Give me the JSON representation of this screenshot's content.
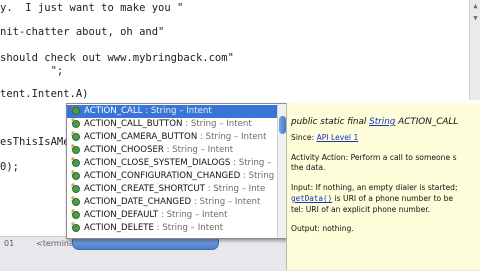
{
  "editor": {
    "lines": [
      "y.  I just want to make you \"",
      "nit-chatter about, oh and\"",
      "should check out www.mybringback.com\"",
      "        \";",
      "tent.Intent.A)",
      "esThisIsAMet",
      "0);"
    ]
  },
  "autocomplete": {
    "items": [
      {
        "name": "ACTION_CALL",
        "type": "String – Intent"
      },
      {
        "name": "ACTION_CALL_BUTTON",
        "type": "String – Intent"
      },
      {
        "name": "ACTION_CAMERA_BUTTON",
        "type": "String – Intent"
      },
      {
        "name": "ACTION_CHOOSER",
        "type": "String – Intent"
      },
      {
        "name": "ACTION_CLOSE_SYSTEM_DIALOGS",
        "type": "String –"
      },
      {
        "name": "ACTION_CONFIGURATION_CHANGED",
        "type": "String"
      },
      {
        "name": "ACTION_CREATE_SHORTCUT",
        "type": "String – Inte"
      },
      {
        "name": "ACTION_DATE_CHANGED",
        "type": "String – Intent"
      },
      {
        "name": "ACTION_DEFAULT",
        "type": "String – Intent"
      },
      {
        "name": "ACTION_DELETE",
        "type": "String – Intent"
      }
    ],
    "separator": " : "
  },
  "javadoc": {
    "signature_prefix": "public static final ",
    "signature_type": "String",
    "signature_name": " ACTION_CALL",
    "since_label": "Since: ",
    "since_link": "API Level 1",
    "description_1": "Activity Action: Perform a call to someone s",
    "description_2": "the data.",
    "input_1": "Input: If nothing, an empty dialer is started;",
    "input_2_code": "getData()",
    "input_2_rest": " is URI of a phone number to be",
    "input_3": "tel: URI of an explicit phone number.",
    "output": "Output: nothing."
  },
  "bottom_panel": {
    "tab_1": "01",
    "tab_2": "<terminated>"
  }
}
